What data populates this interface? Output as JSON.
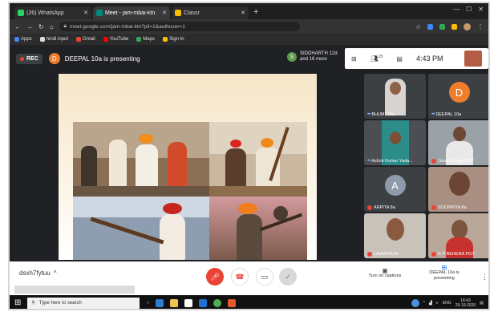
{
  "browser": {
    "tabs": [
      {
        "label": "(26) WhatsApp",
        "color": "#25d366"
      },
      {
        "label": "Meet - jam-mbai-ktn",
        "color": "#00897b"
      },
      {
        "label": "Classr",
        "color": "#fbbc04"
      }
    ],
    "address": "meet.google.com/jam-mbai-ktn?pli=1&authuser=1",
    "bookmarks": [
      {
        "label": "Apps",
        "color": "#4285f4"
      },
      {
        "label": "hindi input",
        "color": "#dddddd"
      },
      {
        "label": "Gmail",
        "color": "#ea4335"
      },
      {
        "label": "YouTube",
        "color": "#ff0000"
      },
      {
        "label": "Maps",
        "color": "#34a853"
      },
      {
        "label": "Sign In",
        "color": "#fbbc04"
      }
    ]
  },
  "meet": {
    "rec_label": "REC",
    "presenter_initial": "D",
    "presenter_text": "DEEPAL 10a is presenting",
    "pinned_initial": "S",
    "pinned_line1": "SIDDHARTH 12d",
    "pinned_line2": "and 16 more",
    "people_count": "25",
    "time": "4:43 PM",
    "participants": [
      {
        "name": "BHUMI 10a",
        "kind": "photo",
        "muted": false
      },
      {
        "name": "DEEPAL 10a",
        "kind": "avatar",
        "initial": "D",
        "color": "#ee7d2c",
        "muted": false
      },
      {
        "name": "Ashok Kumar Yada...",
        "kind": "photo",
        "muted": false
      },
      {
        "name": "Janam Singh PGT",
        "kind": "photo",
        "muted": true
      },
      {
        "name": "ARPITA 8a",
        "kind": "avatar",
        "initial": "A",
        "color": "#8e9aab",
        "muted": true
      },
      {
        "name": "SOOPRIYA 8a",
        "kind": "photo",
        "muted": true
      },
      {
        "name": "LAVANYA 9c",
        "kind": "photo",
        "muted": true
      },
      {
        "name": "R P BEHERA PGT",
        "kind": "photo",
        "muted": true
      }
    ],
    "meeting_code": "dsxh7fytuu",
    "captions_label": "Turn on captions",
    "presenting_label": "DEEPAL 10a is presenting"
  },
  "taskbar": {
    "search_placeholder": "Type here to search",
    "lang": "ENG",
    "time": "16:43",
    "date": "29-10-2020"
  }
}
